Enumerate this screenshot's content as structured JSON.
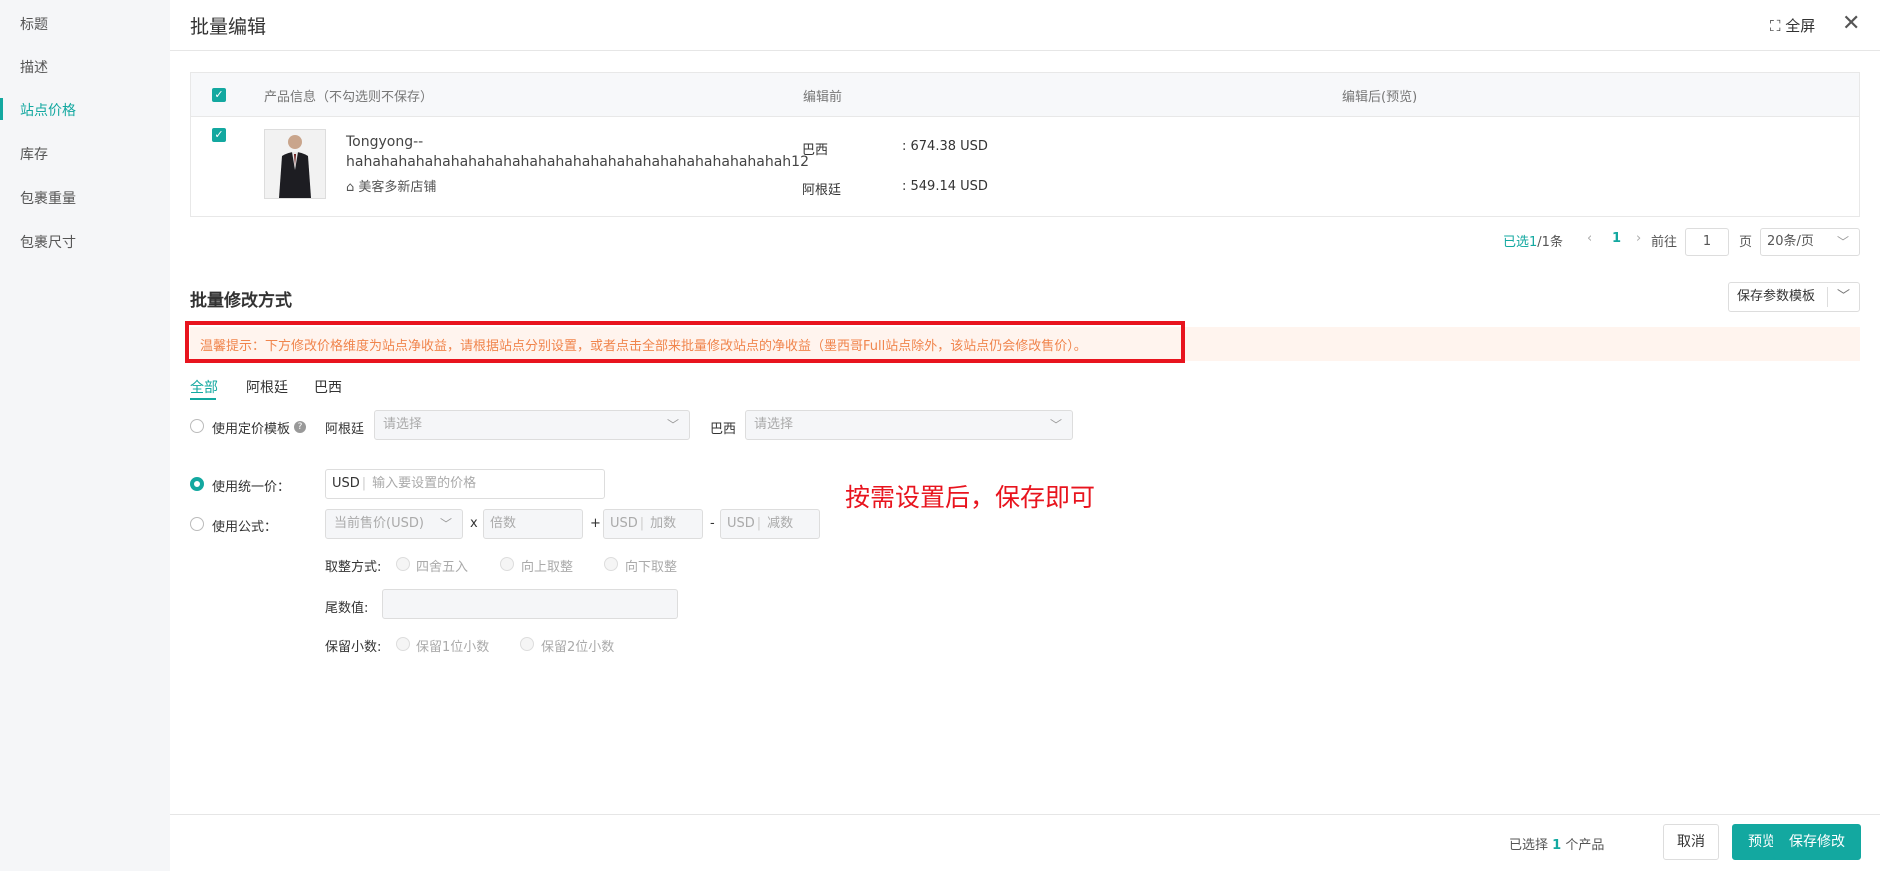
{
  "sidebar": {
    "items": [
      "标题",
      "描述",
      "站点价格",
      "库存",
      "包裹重量",
      "包裹尺寸"
    ]
  },
  "header": {
    "title": "批量编辑",
    "fullscreen": "全屏",
    "close": "✕"
  },
  "table": {
    "headers": {
      "product": "产品信息（不勾选则不保存）",
      "before": "编辑前",
      "after": "编辑后(预览)"
    },
    "row": {
      "name": "Tongyong--hahahahahahahahahahahahahahahahahahahahahahahahahah12",
      "store": "美客多新店铺",
      "before": [
        {
          "site": "巴西",
          "price": ": 674.38 USD"
        },
        {
          "site": "阿根廷",
          "price": ": 549.14 USD"
        }
      ]
    }
  },
  "pagination": {
    "selected_prefix": "已选",
    "selected": "1",
    "total": "/1条",
    "page": "1",
    "goto": "前往",
    "goto_value": "1",
    "page_unit": "页",
    "page_size": "20条/页"
  },
  "batch": {
    "title": "批量修改方式",
    "save_template": "保存参数模板",
    "tip": "温馨提示：下方修改价格维度为站点净收益，请根据站点分别设置，或者点击全部来批量修改站点的净收益（墨西哥Full站点除外，该站点仍会修改售价）。",
    "tabs": [
      "全部",
      "阿根廷",
      "巴西"
    ],
    "template": {
      "label": "使用定价模板",
      "help": "?",
      "argentina": "阿根廷",
      "brazil": "巴西",
      "placeholder": "请选择"
    },
    "uniform": {
      "label": "使用统一价：",
      "currency": "USD",
      "placeholder": "输入要设置的价格"
    },
    "formula": {
      "label": "使用公式：",
      "base": "当前售价(USD)",
      "times": "x",
      "multiplier": "倍数",
      "plus": "+",
      "currency": "USD",
      "add": "加数",
      "minus": "-",
      "subtract": "减数"
    },
    "rounding": {
      "label": "取整方式:",
      "options": [
        "四舍五入",
        "向上取整",
        "向下取整"
      ]
    },
    "tail": {
      "label": "尾数值:"
    },
    "decimals": {
      "label": "保留小数:",
      "options": [
        "保留1位小数",
        "保留2位小数"
      ]
    }
  },
  "annotation": "按需设置后，保存即可",
  "footer": {
    "selected_prefix": "已选择",
    "count": "1",
    "suffix": "个产品",
    "cancel": "取消",
    "preview": "预览",
    "save": "保存修改"
  },
  "colors": {
    "accent": "#13a8a0",
    "warning": "#f0854d",
    "annotation_red": "#e8141e"
  }
}
